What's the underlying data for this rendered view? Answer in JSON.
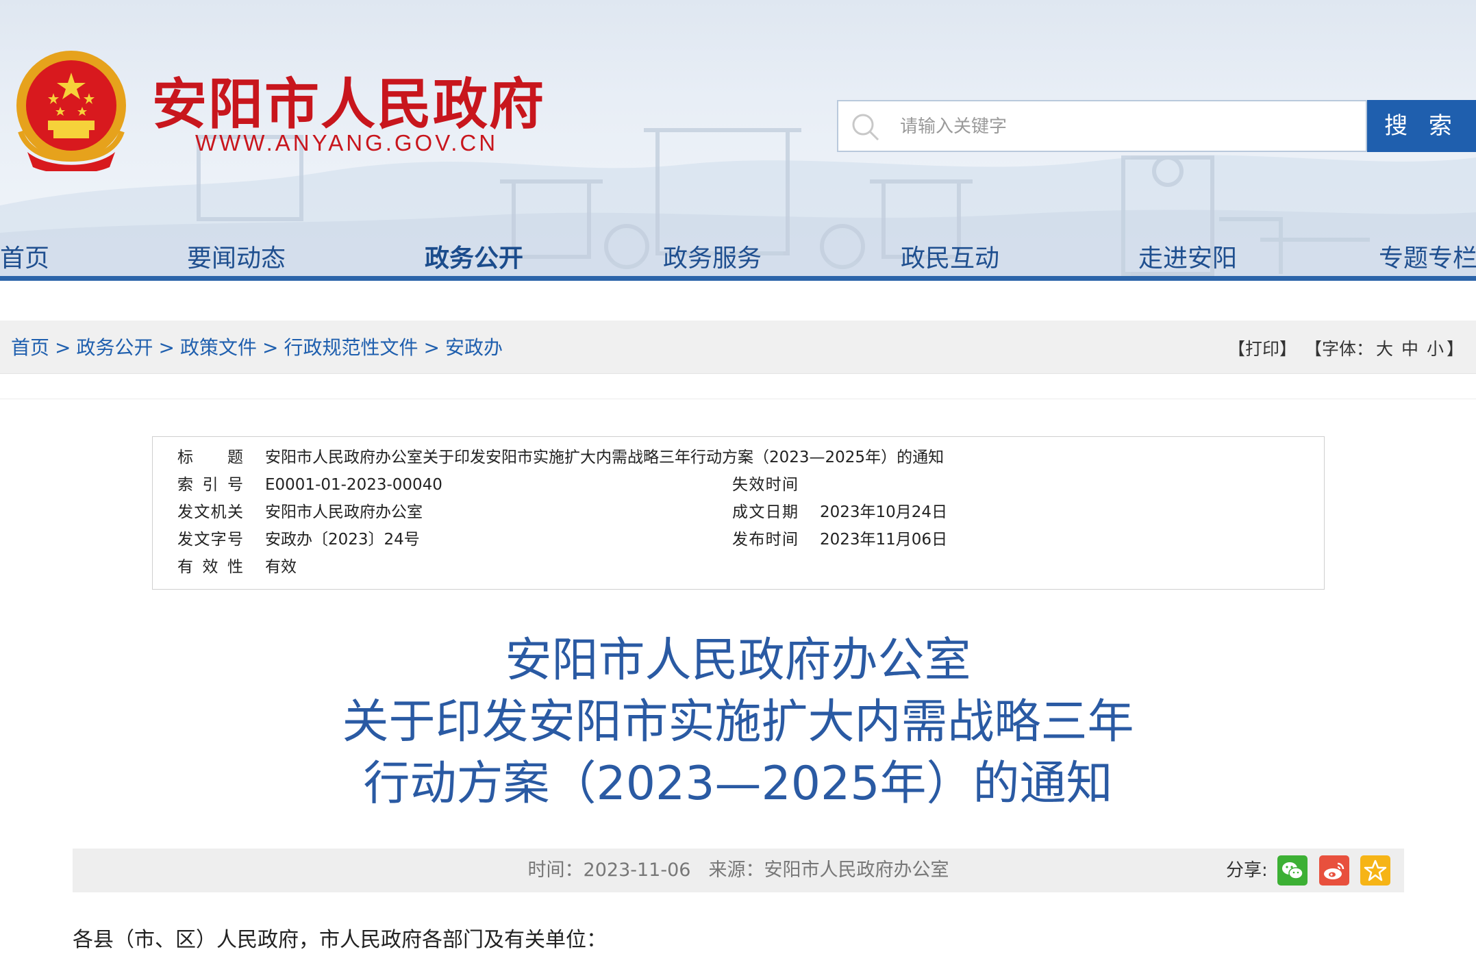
{
  "header": {
    "site_title": "安阳市人民政府",
    "site_url": "WWW.ANYANG.GOV.CN",
    "brand_color": "#c8161d",
    "accent_color": "#1f5fae"
  },
  "search": {
    "placeholder": "请输入关键字",
    "button_label": "搜 索"
  },
  "nav": {
    "items": [
      {
        "label": "首页"
      },
      {
        "label": "要闻动态"
      },
      {
        "label": "政务公开",
        "active": true
      },
      {
        "label": "政务服务"
      },
      {
        "label": "政民互动"
      },
      {
        "label": "走进安阳"
      },
      {
        "label": "专题专栏"
      }
    ]
  },
  "breadcrumb": {
    "items": [
      "首页",
      "政务公开",
      "政策文件",
      "行政规范性文件",
      "安政办"
    ],
    "separator": ">"
  },
  "tools": {
    "print": "【打印】",
    "font_prefix": "【字体：",
    "font_large": "大",
    "font_medium": "中",
    "font_small": "小",
    "font_suffix": "】"
  },
  "meta": {
    "title_label": "标题",
    "title_value": "安阳市人民政府办公室关于印发安阳市实施扩大内需战略三年行动方案（2023—2025年）的通知",
    "index_label": "索引号",
    "index_value": "E0001-01-2023-00040",
    "expire_label": "失效时间",
    "expire_value": "",
    "issuer_label": "发文机关",
    "issuer_value": "安阳市人民政府办公室",
    "written_label": "成文日期",
    "written_value": "2023年10月24日",
    "docno_label": "发文字号",
    "docno_value": "安政办〔2023〕24号",
    "published_label": "发布时间",
    "published_value": "2023年11月06日",
    "validity_label": "有效性",
    "validity_value": "有效"
  },
  "document": {
    "title_lines": [
      "安阳市人民政府办公室",
      "关于印发安阳市实施扩大内需战略三年",
      "行动方案（2023—2025年）的通知"
    ],
    "time": "时间：2023-11-06",
    "source": "来源：安阳市人民政府办公室",
    "share_label": "分享:",
    "salutation": "各县（市、区）人民政府，市人民政府各部门及有关单位："
  },
  "share_icons": [
    {
      "icon": "wechat-icon",
      "color": "#3cb034"
    },
    {
      "icon": "weibo-icon",
      "color": "#e8503d"
    },
    {
      "icon": "star-icon",
      "color": "#f6b416"
    }
  ]
}
